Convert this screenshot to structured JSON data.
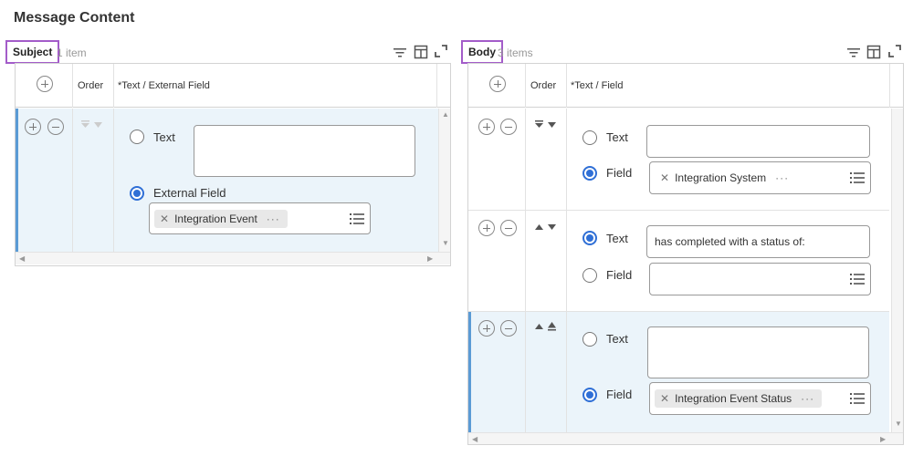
{
  "page": {
    "title": "Message Content"
  },
  "subject": {
    "label": "Subject",
    "count": "1 item",
    "columns": {
      "order": "Order",
      "field": "*Text / External Field"
    },
    "row": {
      "text_label": "Text",
      "text_value": "",
      "field_label": "External Field",
      "field_value": "Integration Event",
      "selected": "field"
    }
  },
  "body": {
    "label": "Body",
    "count": "3 items",
    "columns": {
      "order": "Order",
      "field": "*Text / Field"
    },
    "rows": [
      {
        "text_label": "Text",
        "text_value": "",
        "field_label": "Field",
        "field_value": "Integration System",
        "selected": "field"
      },
      {
        "text_label": "Text",
        "text_value": "has completed with a status of:",
        "field_label": "Field",
        "field_value": "",
        "selected": "text"
      },
      {
        "text_label": "Text",
        "text_value": "",
        "field_label": "Field",
        "field_value": "Integration Event Status",
        "selected": "field"
      }
    ]
  },
  "icons": {
    "filter": "filter-icon",
    "columns": "columns-icon",
    "expand": "expand-icon",
    "add": "add-circle-icon",
    "remove": "remove-circle-icon",
    "list": "list-icon",
    "remove_chip": "close-icon",
    "more": "more-icon",
    "move_up": "move-up-icon",
    "move_down": "move-down-icon"
  },
  "colors": {
    "accent": "#2f6fd6",
    "selection_bar": "#5b9bd5",
    "highlight": "#a35cc9",
    "selected_row": "#ebf4fa"
  }
}
